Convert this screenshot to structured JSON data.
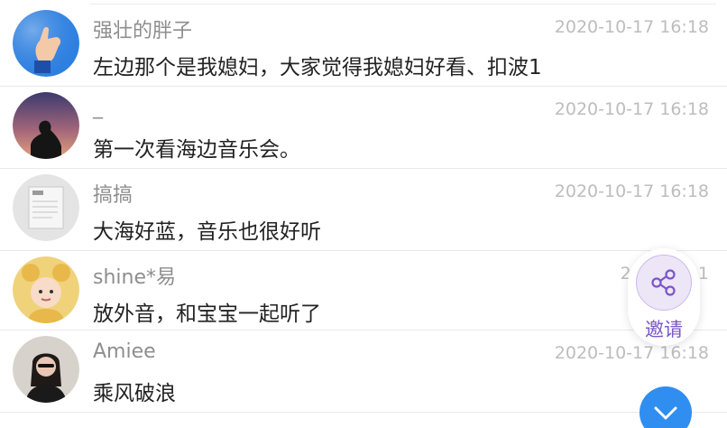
{
  "comments": [
    {
      "user": "强壮的胖子",
      "time": "2020-10-17 16:18",
      "text": "左边那个是我媳妇，大家觉得我媳妇好看、扣波1"
    },
    {
      "user": "_",
      "time": "2020-10-17 16:18",
      "text": "第一次看海边音乐会。"
    },
    {
      "user": "搞搞",
      "time": "2020-10-17 16:18",
      "text": "大海好蓝，音乐也很好听"
    },
    {
      "user": "shine*易",
      "time": "2020-10-1",
      "text": "放外音，和宝宝一起听了"
    },
    {
      "user": "Amiee",
      "time": "2020-10-17 16:18",
      "text": "乘风破浪"
    }
  ],
  "invite": {
    "label": "邀请",
    "icon": "share-icon"
  },
  "scroll": {
    "icon": "chevron-down-icon"
  },
  "colors": {
    "accent": "#2f8ef0",
    "invite": "#7a56c8"
  }
}
